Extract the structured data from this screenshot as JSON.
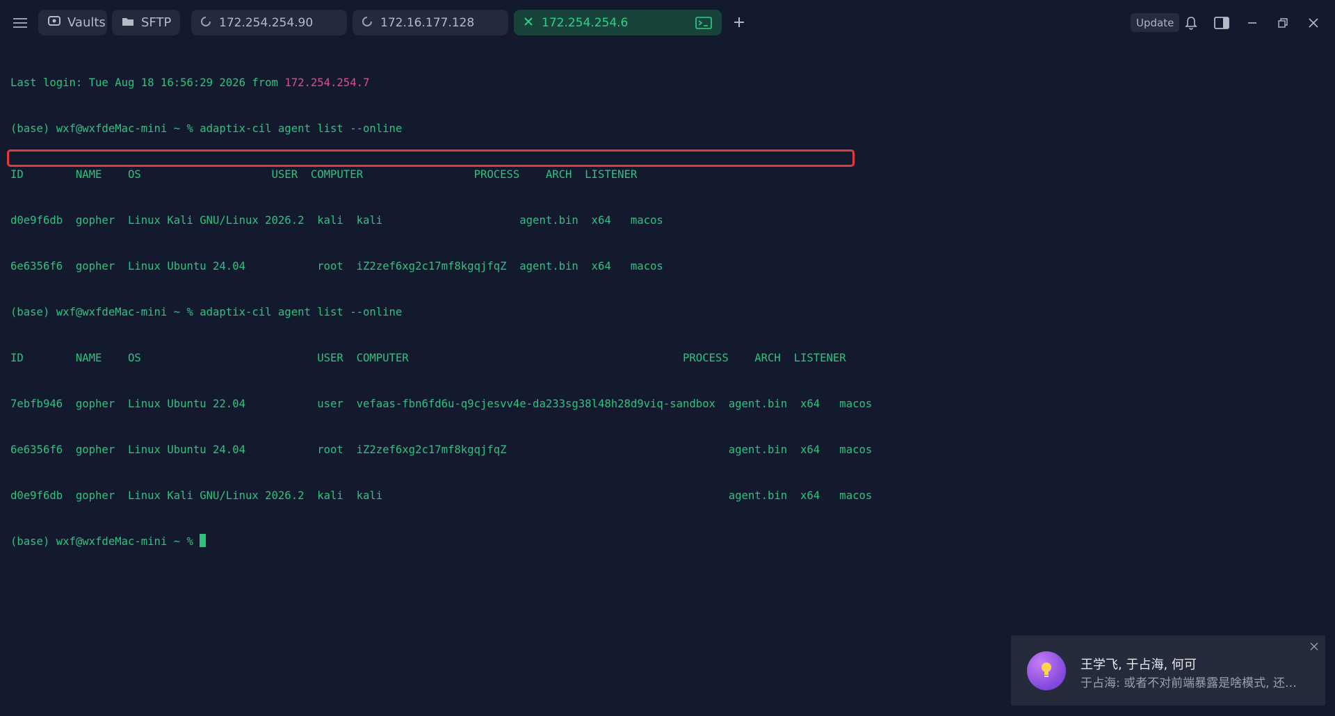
{
  "titlebar": {
    "vaults_label": "Vaults",
    "sftp_label": "SFTP",
    "tabs": [
      {
        "label": "172.254.254.90",
        "icon": "loading-icon",
        "active": false
      },
      {
        "label": "172.16.177.128",
        "icon": "loading-icon",
        "active": false
      },
      {
        "label": "172.254.254.6",
        "icon": "close-icon",
        "active": true,
        "extra_icon": "terminal-icon"
      }
    ],
    "update_label": "Update"
  },
  "terminal": {
    "login_prefix": "Last login: Tue Aug 18 16:56:29 2026 from ",
    "login_ip": "172.254.254.7",
    "lines": [
      "(base) wxf@wxfdeMac-mini ~ % adaptix-cil agent list --online",
      "ID        NAME    OS                    USER  COMPUTER                 PROCESS    ARCH  LISTENER",
      "d0e9f6db  gopher  Linux Kali GNU/Linux 2026.2  kali  kali                     agent.bin  x64   macos",
      "6e6356f6  gopher  Linux Ubuntu 24.04           root  iZ2zef6xg2c17mf8kgqjfqZ  agent.bin  x64   macos",
      "(base) wxf@wxfdeMac-mini ~ % adaptix-cil agent list --online",
      "ID        NAME    OS                           USER  COMPUTER                                          PROCESS    ARCH  LISTENER",
      "7ebfb946  gopher  Linux Ubuntu 22.04           user  vefaas-fbn6fd6u-q9cjesvv4e-da233sg38l48h28d9viq-sandbox  agent.bin  x64   macos",
      "6e6356f6  gopher  Linux Ubuntu 24.04           root  iZ2zef6xg2c17mf8kgqjfqZ                                  agent.bin  x64   macos",
      "d0e9f6db  gopher  Linux Kali GNU/Linux 2026.2  kali  kali                                                     agent.bin  x64   macos"
    ],
    "prompt": "(base) wxf@wxfdeMac-mini ~ % "
  },
  "notification": {
    "title": "王学飞, 于占海, 何可",
    "message": "于占海: 或者不对前端暴露是啥模式, 还是什么",
    "avatar_icon": "lightbulb-icon"
  },
  "colors": {
    "background": "#141a2e",
    "terminal_text": "#2ec27e",
    "highlight": "#e03a3a",
    "ip_highlight": "#e64b8c",
    "active_tab_bg": "#17433a"
  }
}
